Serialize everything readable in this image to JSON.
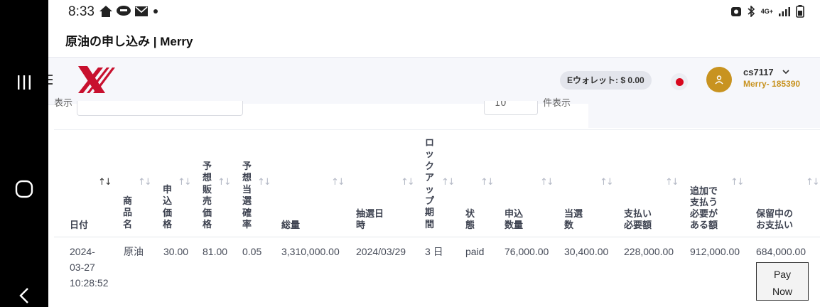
{
  "status": {
    "time": "8:33",
    "network": "4G+"
  },
  "page": {
    "title": "原油の申し込み | Merry"
  },
  "header": {
    "wallet": "Eウォレット: $ 0.00",
    "user_name": "cs7117",
    "user_sub": "Merry- 185390"
  },
  "filters": {
    "show_label": "表示",
    "per_page_value": "10",
    "per_page_label": "件表示"
  },
  "table": {
    "columns": [
      "日付",
      "商品名",
      "申込価格",
      "予想販売価格",
      "予想当選確率",
      "総量",
      "抽選日時",
      "ロックアップ期間",
      "状態",
      "申込数量",
      "当選数",
      "支払い必要額",
      "追加で支払う必要がある額",
      "保留中のお支払い"
    ],
    "column_display": {
      "date": "日付",
      "product": "商品名",
      "apply_price": "申込価格",
      "expected_price": "予想販売価格",
      "win_rate": "予想当選確率",
      "total": "総量",
      "draw_date_l1": "抽選日",
      "draw_date_l2": "時",
      "lockup": "ロックアップ期間",
      "status": "状態",
      "apply_qty_l1": "申込",
      "apply_qty_l2": "数量",
      "win_count_l1": "当選",
      "win_count_l2": "数",
      "pay_required_l1": "支払い",
      "pay_required_l2": "必要額",
      "additional_l1": "追加で",
      "additional_l2": "支払う",
      "additional_l3": "必要が",
      "additional_l4": "ある額",
      "pending_l1": "保留中の",
      "pending_l2": "お支払い"
    },
    "rows": [
      {
        "date_l1": "2024-",
        "date_l2": "03-27",
        "date_l3": "10:28:52",
        "product": "原油",
        "apply_price": "30.00",
        "expected_price": "81.00",
        "win_rate": "0.05",
        "total": "3,310,000.00",
        "draw_date": "2024/03/29",
        "lockup": "3 日",
        "status": "paid",
        "apply_qty": "76,000.00",
        "win_count": "30,400.00",
        "pay_required": "228,000.00",
        "additional": "912,000.00",
        "pending": "684,000.00",
        "action_l1": "Pay",
        "action_l2": "Now"
      }
    ]
  },
  "colors": {
    "accent": "#c89320",
    "logo": "#c8102e",
    "flag": "#d8081e"
  }
}
